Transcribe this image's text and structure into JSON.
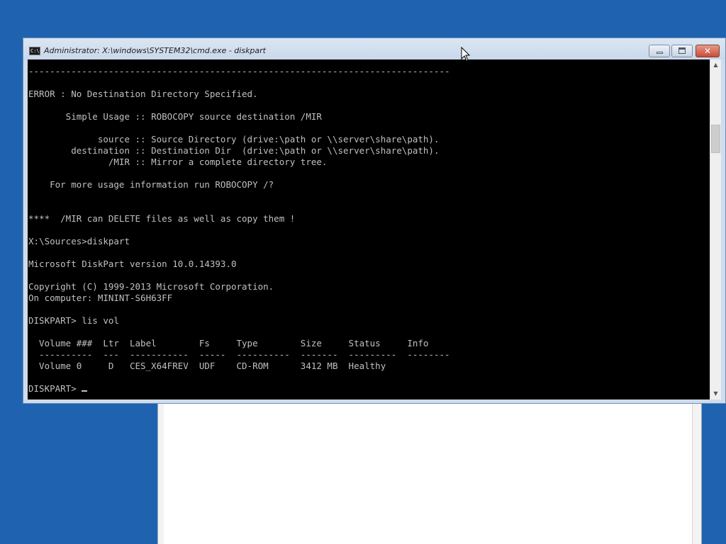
{
  "window": {
    "title": "Administrator: X:\\windows\\SYSTEM32\\cmd.exe - diskpart",
    "icon_label": "C:\\",
    "close_glyph": "✕"
  },
  "console": {
    "lines": [
      "-------------------------------------------------------------------------------",
      "",
      "ERROR : No Destination Directory Specified.",
      "",
      "       Simple Usage :: ROBOCOPY source destination /MIR",
      "",
      "             source :: Source Directory (drive:\\path or \\\\server\\share\\path).",
      "        destination :: Destination Dir  (drive:\\path or \\\\server\\share\\path).",
      "               /MIR :: Mirror a complete directory tree.",
      "",
      "    For more usage information run ROBOCOPY /?",
      "",
      "",
      "****  /MIR can DELETE files as well as copy them !",
      "",
      "X:\\Sources>diskpart",
      "",
      "Microsoft DiskPart version 10.0.14393.0",
      "",
      "Copyright (C) 1999-2013 Microsoft Corporation.",
      "On computer: MININT-S6H63FF",
      "",
      "DISKPART> lis vol",
      "",
      "  Volume ###  Ltr  Label        Fs     Type        Size     Status     Info",
      "  ----------  ---  -----------  -----  ----------  -------  ---------  --------",
      "  Volume 0     D   CES_X64FREV  UDF    CD-ROM      3412 MB  Healthy",
      ""
    ],
    "prompt": "DISKPART> "
  },
  "scrollbar": {
    "up_glyph": "▲",
    "down_glyph": "▼"
  },
  "colors": {
    "desktop": "#1f63b0",
    "console_bg": "#000000",
    "console_fg": "#c0c0c0"
  }
}
